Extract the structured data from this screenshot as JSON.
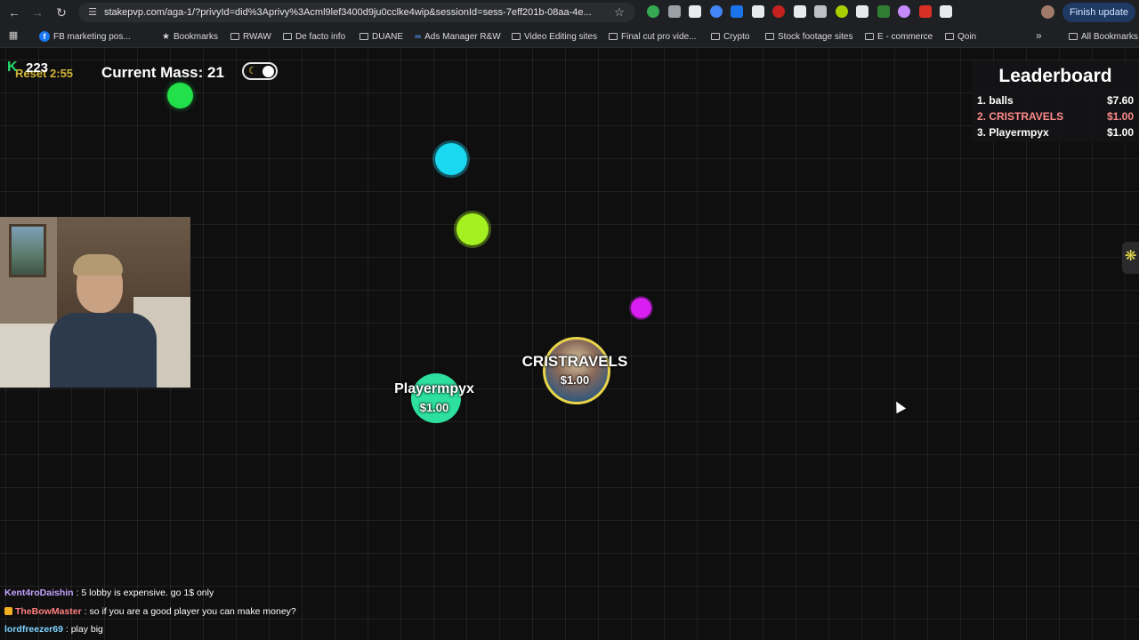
{
  "browser": {
    "url": "stakepvp.com/aga-1/?privyId=did%3Aprivy%3Acml9lef3400d9ju0cclke4wip&sessionId=sess-7eff201b-08aa-4e...",
    "finish_update_label": "Finish update",
    "bookmarks": [
      {
        "label": "FB marketing pos...",
        "icon": "facebook-icon"
      },
      {
        "label": "Bookmarks",
        "icon": "star-icon"
      },
      {
        "label": "RWAW",
        "icon": "folder-icon"
      },
      {
        "label": "De facto info",
        "icon": "folder-icon"
      },
      {
        "label": "DUANE",
        "icon": "folder-icon"
      },
      {
        "label": "Ads Manager R&W",
        "icon": "meta-icon"
      },
      {
        "label": "Video Editing sites",
        "icon": "folder-icon"
      },
      {
        "label": "Final cut pro vide...",
        "icon": "folder-icon"
      },
      {
        "label": "Crypto",
        "icon": "folder-icon"
      },
      {
        "label": "Stock footage sites",
        "icon": "folder-icon"
      },
      {
        "label": "E - commerce",
        "icon": "folder-icon"
      },
      {
        "label": "Qoin",
        "icon": "folder-icon"
      }
    ],
    "all_bookmarks_label": "All Bookmarks",
    "extension_colors": [
      "#34a853",
      "#9aa0a6",
      "#e8eaed",
      "#4285f4",
      "#1a73e8",
      "#e8eaed",
      "#c5221f",
      "#e8eaed",
      "#bdc1c6",
      "#a8d000",
      "#e8eaed",
      "#2e7d32",
      "#c58af9",
      "#d93025",
      "#e8eaed"
    ]
  },
  "hud": {
    "score_icon": "K",
    "score": "223",
    "reset_timer": "Reset 2:55",
    "mass_label": "Current Mass: 21",
    "theme_icon": "moon-icon"
  },
  "leaderboard": {
    "title": "Leaderboard",
    "entries": [
      {
        "name": "1. balls",
        "amount": "$7.60",
        "is_me": false
      },
      {
        "name": "2. CRISTRAVELS",
        "amount": "$1.00",
        "is_me": true
      },
      {
        "name": "3. Playermpyx",
        "amount": "$1.00",
        "is_me": false
      }
    ]
  },
  "players": [
    {
      "name": "CRISTRAVELS",
      "value": "$1.00",
      "color": "#e8d44a"
    },
    {
      "name": "Playermpyx",
      "value": "$1.00",
      "color": "#2de0a0"
    }
  ],
  "food": [
    {
      "color": "#22e04a"
    },
    {
      "color": "#19d8f0"
    },
    {
      "color": "#a4f020"
    },
    {
      "color": "#d81ef0"
    }
  ],
  "side_tab_icon": "asterisk-icon",
  "chat": [
    {
      "user": "Kent4roDaishin",
      "message": ": 5 lobby is expensive. go 1$ only",
      "color": "#c3a4ff",
      "badge": false
    },
    {
      "user": "TheBowMaster",
      "message": ": so if you are a good player you can make money?",
      "color": "#ff7f7f",
      "badge": true
    },
    {
      "user": "lordfreezer69",
      "message": ": play big",
      "color": "#7fd4ff",
      "badge": false
    }
  ]
}
